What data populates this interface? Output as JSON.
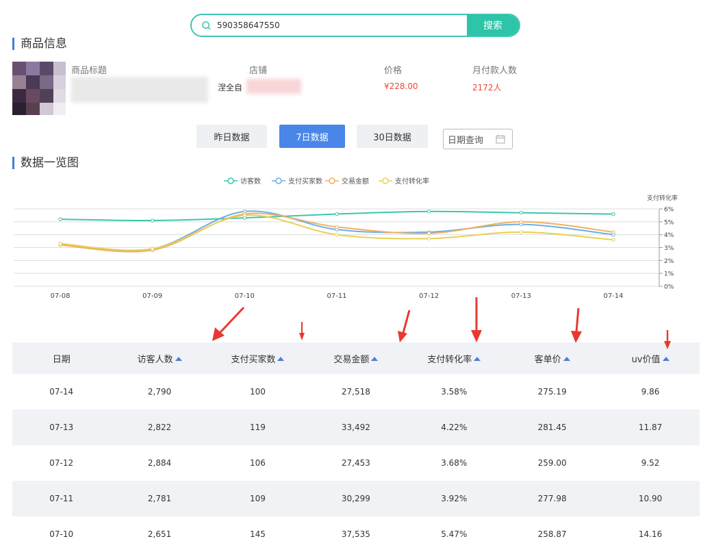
{
  "search": {
    "value": "590358647550",
    "button_label": "搜索"
  },
  "product": {
    "section_title": "商品信息",
    "headers": {
      "title": "商品标题",
      "shop": "店铺",
      "price": "价格",
      "monthly_buyers": "月付款人数"
    },
    "shop_visible": "涅全自",
    "price": "¥228.00",
    "monthly_buyers": "2172人"
  },
  "range_buttons": {
    "yesterday": "昨日数据",
    "seven_days": "7日数据",
    "thirty_days": "30日数据",
    "date_query": "日期查询"
  },
  "chart_section_title": "数据一览图",
  "colors": {
    "accent": "#4a86e8",
    "teal": "#2ec4a9",
    "price_red": "#e84a3a",
    "arrow_red": "#e8392e"
  },
  "chart_data": {
    "type": "line",
    "x": [
      "07-08",
      "07-09",
      "07-10",
      "07-11",
      "07-12",
      "07-13",
      "07-14"
    ],
    "legend": [
      "访客数",
      "支付买家数",
      "交易金额",
      "支付转化率"
    ],
    "right_axis_label": "支付转化率",
    "right_ticks": [
      "6%",
      "5%",
      "4%",
      "3%",
      "2%",
      "1%",
      "0%"
    ],
    "right_ylim": [
      0,
      6
    ],
    "grid": true,
    "legend_position": "top-center",
    "series": [
      {
        "name": "访客数",
        "color": "#3cc6b0",
        "values": [
          5.2,
          5.1,
          5.3,
          5.6,
          5.8,
          5.7,
          5.6
        ]
      },
      {
        "name": "支付买家数",
        "color": "#6aaee8",
        "values": [
          3.3,
          2.9,
          5.8,
          4.4,
          4.2,
          4.8,
          4.0
        ]
      },
      {
        "name": "交易金额",
        "color": "#f0b060",
        "values": [
          3.2,
          2.8,
          5.6,
          4.6,
          4.1,
          5.0,
          4.2
        ]
      },
      {
        "name": "支付转化率",
        "color": "#e8d050",
        "values": [
          3.3,
          2.9,
          5.5,
          4.0,
          3.7,
          4.2,
          3.6
        ]
      }
    ]
  },
  "table": {
    "headers": [
      "日期",
      "访客人数",
      "支付买家数",
      "交易金额",
      "支付转化率",
      "客单价",
      "uv价值"
    ],
    "rows": [
      [
        "07-14",
        "2,790",
        "100",
        "27,518",
        "3.58%",
        "275.19",
        "9.86"
      ],
      [
        "07-13",
        "2,822",
        "119",
        "33,492",
        "4.22%",
        "281.45",
        "11.87"
      ],
      [
        "07-12",
        "2,884",
        "106",
        "27,453",
        "3.68%",
        "259.00",
        "9.52"
      ],
      [
        "07-11",
        "2,781",
        "109",
        "30,299",
        "3.92%",
        "277.98",
        "10.90"
      ],
      [
        "07-10",
        "2,651",
        "145",
        "37,535",
        "5.47%",
        "258.87",
        "14.16"
      ]
    ]
  }
}
